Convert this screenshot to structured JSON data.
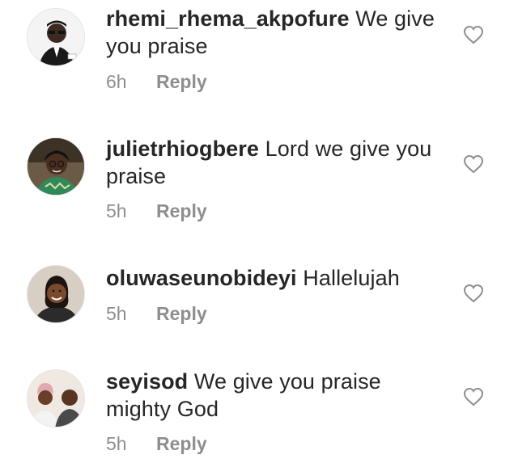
{
  "comments": [
    {
      "username": "rhemi_rhema_akpofure",
      "text": "We give you praise",
      "time": "6h",
      "reply_label": "Reply",
      "avatar_icon": "avatar-man-in-suit-with-glasses"
    },
    {
      "username": "julietrhiogbere",
      "text": "Lord we give you praise",
      "time": "5h",
      "reply_label": "Reply",
      "avatar_icon": "avatar-woman-with-glasses"
    },
    {
      "username": "oluwaseunobideyi",
      "text": "Hallelujah",
      "time": "5h",
      "reply_label": "Reply",
      "avatar_icon": "avatar-woman-smiling"
    },
    {
      "username": "seyisod",
      "text": "We give you praise mighty God",
      "time": "5h",
      "reply_label": "Reply",
      "avatar_icon": "avatar-couple-wedding"
    }
  ],
  "colors": {
    "text": "#262626",
    "secondary": "#8e8e8e",
    "icon_stroke": "#8e8e8e"
  }
}
